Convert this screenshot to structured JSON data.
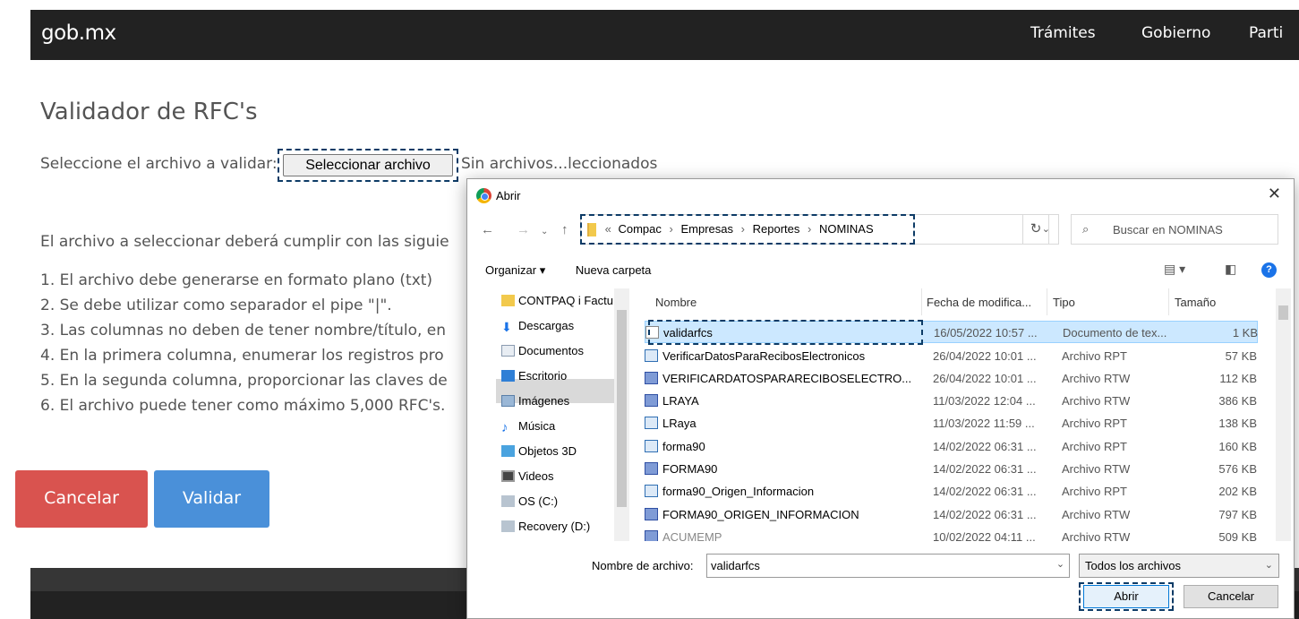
{
  "site": {
    "logo": "gob.mx",
    "nav": [
      "Trámites",
      "Gobierno",
      "Parti"
    ],
    "title": "Validador de RFC's",
    "file_label": "Seleccione el archivo a validar:",
    "file_button": "Seleccionar archivo",
    "file_status": "Sin archivos...leccionados",
    "requirements_intro": "El archivo a seleccionar deberá cumplir con las siguie",
    "requirements": [
      "1. El archivo debe generarse en formato plano (txt)",
      "2. Se debe utilizar como separador el pipe \"|\".",
      "3. Las columnas no deben de tener nombre/título, en",
      "4. En la primera columna, enumerar los registros pro",
      "5. En la segunda columna, proporcionar las claves de",
      "6. El archivo puede tener como máximo 5,000 RFC's."
    ],
    "cancel_button": "Cancelar",
    "validate_button": "Validar"
  },
  "dialog": {
    "title": "Abrir",
    "breadcrumb": [
      "«",
      "Compac",
      "›",
      "Empresas",
      "›",
      "Reportes",
      "›",
      "NOMINAS"
    ],
    "search_placeholder": "Buscar en NOMINAS",
    "organize": "Organizar ▾",
    "new_folder": "Nueva carpeta",
    "tree": [
      {
        "label": "CONTPAQ i Factu",
        "icon": "folder-icon"
      },
      {
        "label": "Descargas",
        "icon": "download-icon"
      },
      {
        "label": "Documentos",
        "icon": "documents-icon"
      },
      {
        "label": "Escritorio",
        "icon": "desktop-icon"
      },
      {
        "label": "Imágenes",
        "icon": "pictures-icon"
      },
      {
        "label": "Música",
        "icon": "music-icon"
      },
      {
        "label": "Objetos 3D",
        "icon": "objects-3d-icon"
      },
      {
        "label": "Videos",
        "icon": "videos-icon"
      },
      {
        "label": "OS (C:)",
        "icon": "drive-icon"
      },
      {
        "label": "Recovery (D:)",
        "icon": "drive-icon"
      }
    ],
    "columns": [
      "Nombre",
      "Fecha de modifica...",
      "Tipo",
      "Tamaño"
    ],
    "files": [
      {
        "name": "validarfcs",
        "date": "16/05/2022 10:57 ...",
        "type": "Documento de tex...",
        "size": "1 KB",
        "icon": "text-file-icon"
      },
      {
        "name": "VerificarDatosParaRecibosElectronicos",
        "date": "26/04/2022 10:01 ...",
        "type": "Archivo RPT",
        "size": "57 KB",
        "icon": "rpt-file-icon"
      },
      {
        "name": "VERIFICARDATOSPARARECIBOSELECTRO...",
        "date": "26/04/2022 10:01 ...",
        "type": "Archivo RTW",
        "size": "112 KB",
        "icon": "rtw-file-icon"
      },
      {
        "name": "LRAYA",
        "date": "11/03/2022 12:04 ...",
        "type": "Archivo RTW",
        "size": "386 KB",
        "icon": "rtw-file-icon"
      },
      {
        "name": "LRaya",
        "date": "11/03/2022 11:59 ...",
        "type": "Archivo RPT",
        "size": "138 KB",
        "icon": "rpt-file-icon"
      },
      {
        "name": "forma90",
        "date": "14/02/2022 06:31 ...",
        "type": "Archivo RPT",
        "size": "160 KB",
        "icon": "rpt-file-icon"
      },
      {
        "name": "FORMA90",
        "date": "14/02/2022 06:31 ...",
        "type": "Archivo RTW",
        "size": "576 KB",
        "icon": "rtw-file-icon"
      },
      {
        "name": "forma90_Origen_Informacion",
        "date": "14/02/2022 06:31 ...",
        "type": "Archivo RPT",
        "size": "202 KB",
        "icon": "rpt-file-icon"
      },
      {
        "name": "FORMA90_ORIGEN_INFORMACION",
        "date": "14/02/2022 06:31 ...",
        "type": "Archivo RTW",
        "size": "797 KB",
        "icon": "rtw-file-icon"
      },
      {
        "name": "ACUMEMP",
        "date": "10/02/2022 04:11 ...",
        "type": "Archivo RTW",
        "size": "509 KB",
        "icon": "rtw-file-icon"
      }
    ],
    "filename_label": "Nombre de archivo:",
    "filename_value": "validarfcs",
    "filter": "Todos los archivos",
    "open_button": "Abrir",
    "cancel_button": "Cancelar"
  }
}
